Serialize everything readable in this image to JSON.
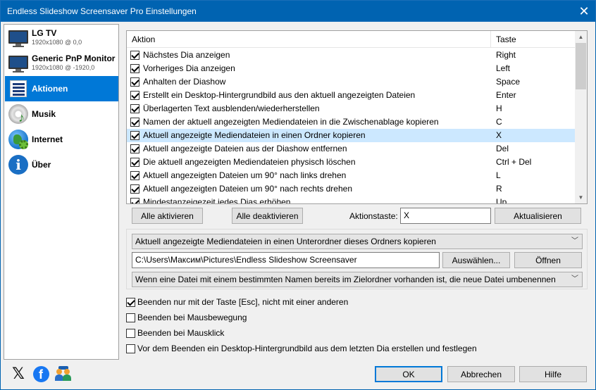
{
  "window": {
    "title": "Endless Slideshow Screensaver Pro Einstellungen",
    "close_glyph": "✕"
  },
  "sidebar": {
    "items": [
      {
        "label": "LG TV",
        "sub": "1920x1080 @ 0,0",
        "icon": "monitor-icon"
      },
      {
        "label": "Generic PnP Monitor",
        "sub": "1920x1080 @ -1920,0",
        "icon": "monitor-icon"
      },
      {
        "label": "Aktionen",
        "sub": "",
        "icon": "list-icon",
        "selected": true
      },
      {
        "label": "Musik",
        "sub": "",
        "icon": "music-disc-icon"
      },
      {
        "label": "Internet",
        "sub": "",
        "icon": "globe-icon"
      },
      {
        "label": "Über",
        "sub": "",
        "icon": "info-icon"
      }
    ]
  },
  "actions_table": {
    "headers": {
      "action": "Aktion",
      "key": "Taste"
    },
    "rows": [
      {
        "checked": true,
        "action": "Nächstes Dia anzeigen",
        "key": "Right"
      },
      {
        "checked": true,
        "action": "Vorheriges Dia anzeigen",
        "key": "Left"
      },
      {
        "checked": true,
        "action": "Anhalten der Diashow",
        "key": "Space"
      },
      {
        "checked": true,
        "action": "Erstellt ein Desktop-Hintergrundbild aus den aktuell angezeigten Dateien",
        "key": "Enter"
      },
      {
        "checked": true,
        "action": "Überlagerten Text ausblenden/wiederherstellen",
        "key": "H"
      },
      {
        "checked": true,
        "action": "Namen der aktuell angezeigten Mediendateien in die Zwischenablage kopieren",
        "key": "C"
      },
      {
        "checked": true,
        "action": "Aktuell angezeigte Mediendateien in einen Ordner kopieren",
        "key": "X",
        "selected": true
      },
      {
        "checked": true,
        "action": "Aktuell angezeigte Dateien aus der Diashow entfernen",
        "key": "Del"
      },
      {
        "checked": true,
        "action": "Die aktuell angezeigten Mediendateien physisch löschen",
        "key": "Ctrl + Del"
      },
      {
        "checked": true,
        "action": "Aktuell angezeigten Dateien um 90° nach links drehen",
        "key": "L"
      },
      {
        "checked": true,
        "action": "Aktuell angezeigten Dateien um 90° nach rechts drehen",
        "key": "R"
      },
      {
        "checked": true,
        "action": "Mindestanzeigezeit jedes Dias erhöhen",
        "key": "Up"
      }
    ]
  },
  "buttons": {
    "enable_all": "Alle aktivieren",
    "disable_all": "Alle deaktivieren",
    "update": "Aktualisieren",
    "browse": "Auswählen...",
    "open": "Öffnen",
    "ok": "OK",
    "cancel": "Abbrechen",
    "help": "Hilfe"
  },
  "action_key": {
    "label": "Aktionstaste:",
    "value": "X"
  },
  "action_details": {
    "mode_select": "Aktuell angezeigte Mediendateien in einen Unterordner dieses Ordners kopieren",
    "folder_path": "C:\\Users\\Максим\\Pictures\\Endless Slideshow Screensaver",
    "conflict_select": "Wenn eine Datei mit einem bestimmten Namen bereits im Zielordner vorhanden ist, die neue Datei umbenennen"
  },
  "options": [
    {
      "checked": true,
      "label": "Beenden nur mit der Taste [Esc], nicht mit einer anderen"
    },
    {
      "checked": false,
      "label": "Beenden bei Mausbewegung"
    },
    {
      "checked": false,
      "label": "Beenden bei Mausklick"
    },
    {
      "checked": false,
      "label": "Vor dem Beenden ein Desktop-Hintergrundbild aus dem letzten Dia erstellen und festlegen"
    }
  ],
  "social": {
    "x_glyph": "𝕏",
    "facebook_glyph": "f"
  },
  "colors": {
    "titlebar": "#0063b1",
    "selection": "#0078d7",
    "row_highlight": "#cce8ff"
  }
}
